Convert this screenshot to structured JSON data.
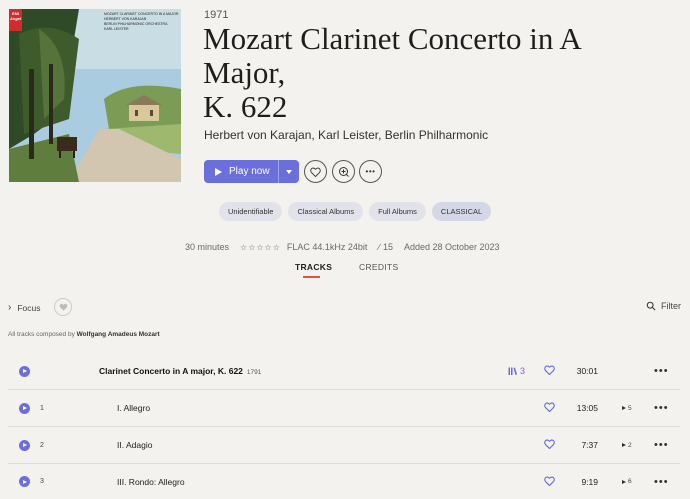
{
  "album": {
    "cover_text": {
      "label_top": "EMI",
      "label_bottom": "Angel",
      "lines": [
        "MOZART CLARINET CONCERTO IN A MAJOR",
        "HERBERT VON KARAJAN",
        "BERLIN PHILHARMONIC ORCHESTRA",
        "KARL LEISTER"
      ]
    },
    "year": "1971",
    "title_line1": "Mozart Clarinet Concerto in A",
    "title_line2": "Major,",
    "title_line3": "K. 622",
    "artists": "Herbert von Karajan, Karl Leister, Berlin Philharmonic"
  },
  "actions": {
    "play_label": "Play now",
    "more_icon": "•••"
  },
  "tags": [
    "Unidentifiable",
    "Classical Albums",
    "Full Albums",
    "CLASSICAL"
  ],
  "meta": {
    "duration": "30 minutes",
    "stars": "☆☆☆☆☆",
    "format": "FLAC 44.1kHz 24bit",
    "tracks_count": "15",
    "added": "Added 28 October 2023"
  },
  "tabs": {
    "tracks": "TRACKS",
    "credits": "CREDITS"
  },
  "toolbar": {
    "focus": "Focus",
    "filter": "Filter"
  },
  "composer": {
    "prefix": "All tracks composed by ",
    "name": "Wolfgang Amadeus Mozart"
  },
  "work": {
    "title": "Clarinet Concerto in A major, K. 622",
    "year": "1791",
    "parts": "3",
    "duration": "30:01"
  },
  "tracks": [
    {
      "number": "1",
      "title": "I. Allegro",
      "duration": "13:05",
      "plays": "5"
    },
    {
      "number": "2",
      "title": "II. Adagio",
      "duration": "7:37",
      "plays": "2"
    },
    {
      "number": "3",
      "title": "III. Rondo: Allegro",
      "duration": "9:19",
      "plays": "6"
    }
  ],
  "colors": {
    "accent": "#6b6fdc",
    "tab_underline": "#e0513f",
    "background": "#f3f2ef"
  }
}
